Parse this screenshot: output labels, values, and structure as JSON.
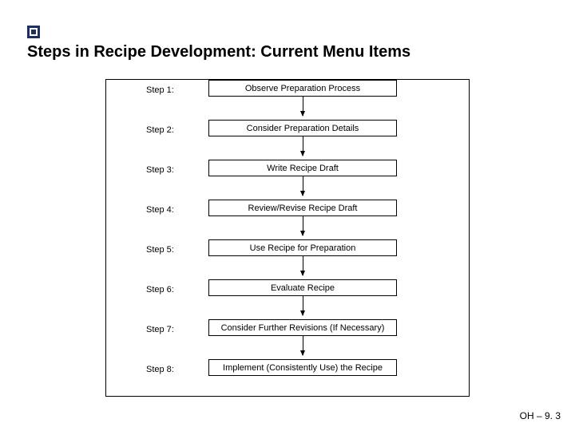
{
  "title": "Steps in Recipe Development: Current Menu Items",
  "steps": [
    {
      "label": "Step 1:",
      "text": "Observe Preparation Process"
    },
    {
      "label": "Step 2:",
      "text": "Consider Preparation Details"
    },
    {
      "label": "Step 3:",
      "text": "Write Recipe Draft"
    },
    {
      "label": "Step 4:",
      "text": "Review/Revise Recipe Draft"
    },
    {
      "label": "Step 5:",
      "text": "Use Recipe for Preparation"
    },
    {
      "label": "Step 6:",
      "text": "Evaluate Recipe"
    },
    {
      "label": "Step 7:",
      "text": "Consider Further Revisions (If Necessary)"
    },
    {
      "label": "Step 8:",
      "text": "Implement (Consistently Use) the Recipe"
    }
  ],
  "footer": "OH – 9. 3"
}
